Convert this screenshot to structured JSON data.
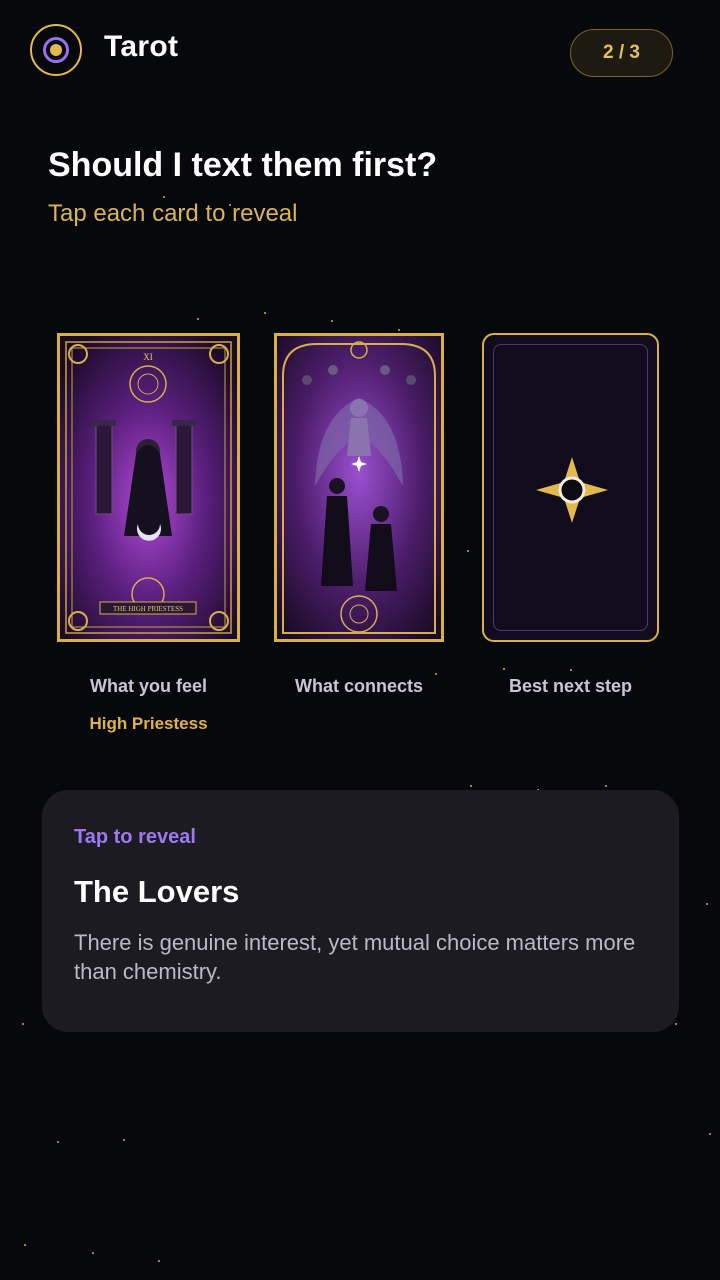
{
  "header": {
    "title": "Tarot",
    "progress": "2 / 3",
    "logo_icon": "tarot-logo-icon"
  },
  "reading": {
    "question": "Should I text them first?",
    "instruction": "Tap each card to reveal"
  },
  "cards": [
    {
      "position": "What you feel",
      "name": "High Priestess",
      "state": "revealed",
      "numeral": "XI",
      "banner": "THE HIGH PRIESTESS"
    },
    {
      "position": "What connects",
      "name": "",
      "state": "revealed"
    },
    {
      "position": "Best next step",
      "name": "",
      "state": "face-down"
    }
  ],
  "panel": {
    "hint": "Tap to reveal",
    "title": "The Lovers",
    "text": "There is genuine interest, yet mutual choice matters more than chemistry."
  },
  "colors": {
    "accent_gold": "#e3b84e",
    "accent_purple": "#9d78f0",
    "background": "#07080b",
    "panel": "#1b1b21"
  }
}
